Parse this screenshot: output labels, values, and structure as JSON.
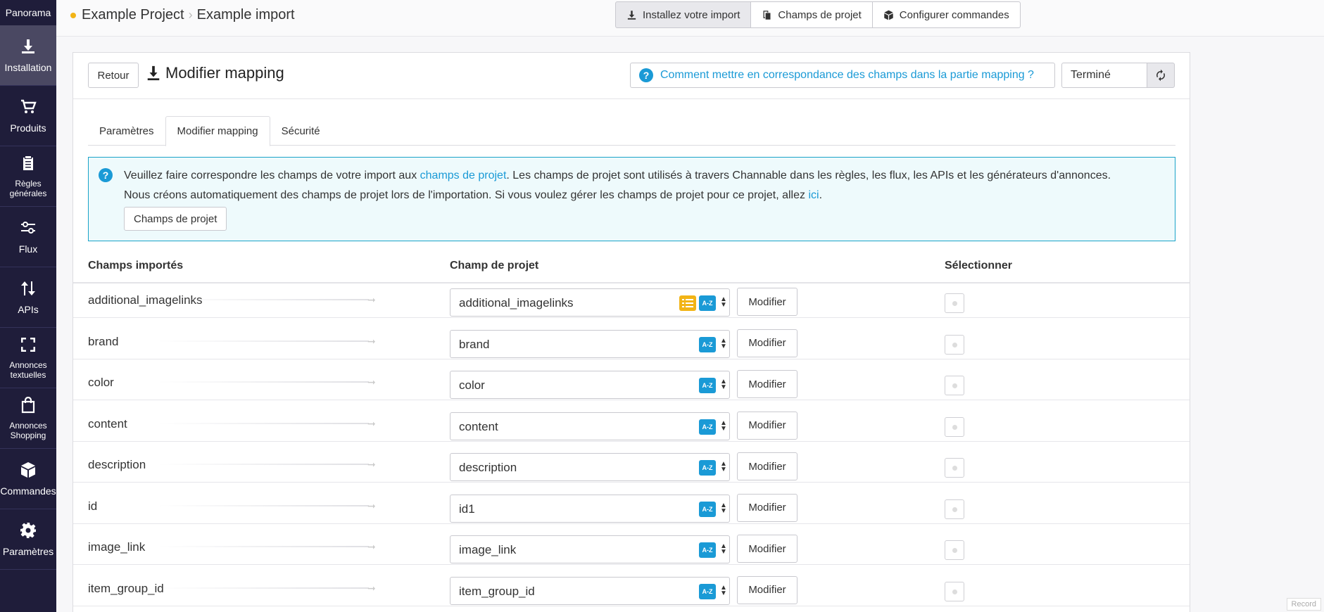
{
  "sidebar": {
    "top_label": "Panorama",
    "items": [
      {
        "label": "Installation",
        "icon": "download-icon",
        "active": true
      },
      {
        "label": "Produits",
        "icon": "cart-icon"
      },
      {
        "label": "Règles générales",
        "icon": "clipboard-icon"
      },
      {
        "label": "Flux",
        "icon": "sliders-icon"
      },
      {
        "label": "APIs",
        "icon": "arrows-updown-icon"
      },
      {
        "label": "Annonces textuelles",
        "icon": "frame-corners-icon"
      },
      {
        "label": "Annonces Shopping",
        "icon": "shopping-bag-icon"
      },
      {
        "label": "Commandes",
        "icon": "box-icon"
      },
      {
        "label": "Paramètres",
        "icon": "gear-icon"
      }
    ]
  },
  "header": {
    "project": "Example Project",
    "page": "Example import",
    "buttons": [
      {
        "label": "Installez votre import",
        "icon": "download-icon"
      },
      {
        "label": "Champs de projet",
        "icon": "copy-icon"
      },
      {
        "label": "Configurer commandes",
        "icon": "box-icon"
      }
    ]
  },
  "card": {
    "back_label": "Retour",
    "title": "Modifier mapping",
    "help_link": "Comment mettre en correspondance des champs dans la partie mapping ?",
    "status": "Terminé"
  },
  "tabs": [
    "Paramètres",
    "Modifier mapping",
    "Sécurité"
  ],
  "info": {
    "part1": "Veuillez faire correspondre les champs de votre import aux ",
    "link1": "champs de projet",
    "part2": ". Les champs de projet sont utilisés à travers Channable dans les règles, les flux, les APIs et les générateurs d'annonces.",
    "part3": "Nous créons automatiquement des champs de projet lors de l'importation. Si vous voulez gérer les champs de projet pour ce projet, allez ",
    "link2": "ici",
    "part4": ".",
    "button": "Champs de projet"
  },
  "table": {
    "headers": [
      "Champs importés",
      "Champ de projet",
      "Sélectionner"
    ],
    "modify_label": "Modifier",
    "az_label": "A-Z",
    "rows": [
      {
        "imported": "additional_imagelinks",
        "project": "additional_imagelinks",
        "list": true
      },
      {
        "imported": "brand",
        "project": "brand"
      },
      {
        "imported": "color",
        "project": "color"
      },
      {
        "imported": "content",
        "project": "content"
      },
      {
        "imported": "description",
        "project": "description"
      },
      {
        "imported": "id",
        "project": "id1"
      },
      {
        "imported": "image_link",
        "project": "image_link"
      },
      {
        "imported": "item_group_id",
        "project": "item_group_id"
      }
    ]
  },
  "footer": {
    "record": "Record"
  }
}
